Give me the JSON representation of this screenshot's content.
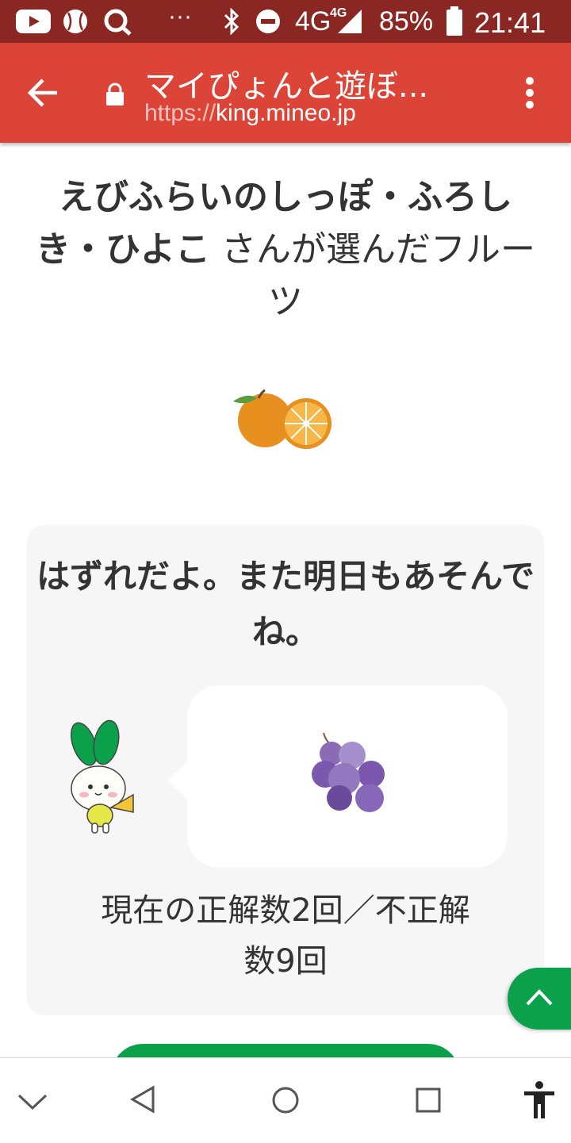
{
  "status_bar": {
    "icons": [
      "youtube-icon",
      "baseball-icon",
      "search-app-icon",
      "more-dots-icon",
      "bluetooth-icon",
      "do-not-disturb-icon",
      "signal-icon",
      "battery-icon"
    ],
    "more": "···",
    "network": "4G",
    "network_small": "4G",
    "battery": "85%",
    "time": "21:41"
  },
  "browser": {
    "back_icon": "back-arrow-icon",
    "lock_icon": "lock-icon",
    "page_title": "マイぴょんと遊ぼ...",
    "url_scheme": "https://",
    "url_host": "king.mineo.jp",
    "menu_icon": "overflow-menu-icon"
  },
  "content": {
    "chooser_name": "えびふらいのしっぽ・ふろしき・ひよこ",
    "chooser_suffix": "さんが選んだフルーツ",
    "chosen_fruit_icon": "orange-icon",
    "result_message": "はずれだよ。また明日もあそんでね。",
    "mascot_icon": "mascot-rabbit-icon",
    "revealed_fruit_icon": "grapes-icon",
    "score_line1": "現在の正解数2回／不正解",
    "score_line2": "数9回",
    "scroll_top_icon": "chevron-up-icon"
  },
  "colors": {
    "status_bar": "#8a2722",
    "browser_bar": "#db4437",
    "accent_green": "#0aa14a",
    "card_bg": "#f5f6f5"
  },
  "nav_bar": {
    "icons": [
      "chevron-down-icon",
      "back-triangle-icon",
      "home-circle-icon",
      "recents-square-icon",
      "accessibility-icon"
    ]
  }
}
